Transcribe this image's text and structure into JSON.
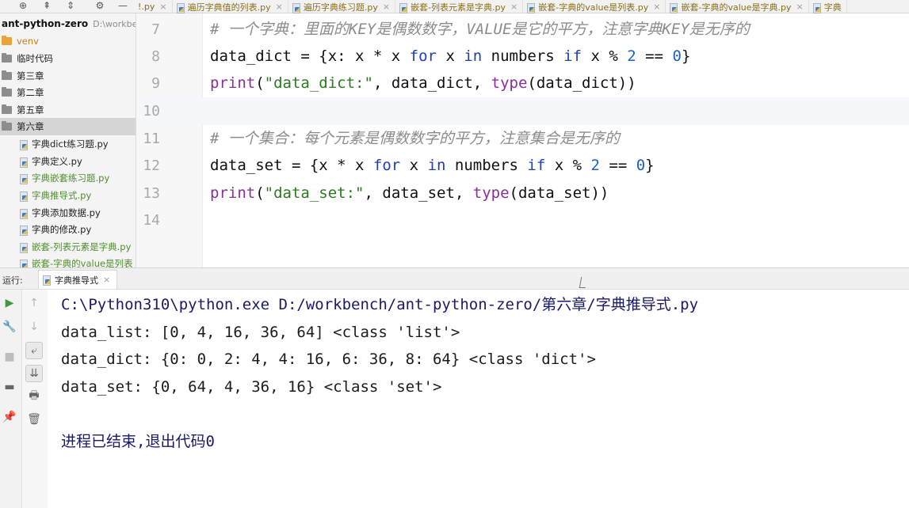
{
  "toolbar": {
    "target_icon": "crosshair-icon",
    "collapse_icon": "collapse-all-icon",
    "expand_icon": "expand-icon",
    "settings_icon": "gear-icon",
    "minimize_icon": "minimize-icon"
  },
  "tabs": [
    {
      "label": "!.py",
      "close": "×"
    },
    {
      "label": "遍历字典值的列表.py",
      "close": "×"
    },
    {
      "label": "遍历字典练习题.py",
      "close": "×"
    },
    {
      "label": "嵌套-列表元素是字典.py",
      "close": "×"
    },
    {
      "label": "嵌套-字典的value是列表.py",
      "close": "×"
    },
    {
      "label": "嵌套-字典的value是字典.py",
      "close": "×"
    },
    {
      "label": "字典",
      "close": ""
    }
  ],
  "sidebar": {
    "root_title": "ant-python-zero",
    "root_path": "D:\\workbench",
    "items": [
      {
        "label": "venv",
        "type": "folder-orange"
      },
      {
        "label": "临时代码",
        "type": "folder"
      },
      {
        "label": "第三章",
        "type": "folder"
      },
      {
        "label": "第二章",
        "type": "folder"
      },
      {
        "label": "第五章",
        "type": "folder"
      },
      {
        "label": "第六章",
        "type": "folder-selected"
      },
      {
        "label": "字典dict练习题.py",
        "type": "file"
      },
      {
        "label": "字典定义.py",
        "type": "file"
      },
      {
        "label": "字典嵌套练习题.py",
        "type": "file-green"
      },
      {
        "label": "字典推导式.py",
        "type": "file-green"
      },
      {
        "label": "字典添加数据.py",
        "type": "file"
      },
      {
        "label": "字典的修改.py",
        "type": "file"
      },
      {
        "label": "嵌套-列表元素是字典.py",
        "type": "file-green"
      },
      {
        "label": "嵌套-字典的value是列表",
        "type": "file-green"
      }
    ]
  },
  "editor": {
    "current_line": 10,
    "lines": [
      {
        "num": "7",
        "text": "# 一个字典：里面的KEY是偶数数字，VALUE是它的平方，注意字典KEY是无序的"
      },
      {
        "num": "8",
        "text": "data_dict = {x: x * x for x in numbers if x % 2 == 0}"
      },
      {
        "num": "9",
        "text": "print(\"data_dict:\", data_dict, type(data_dict))"
      },
      {
        "num": "10",
        "text": ""
      },
      {
        "num": "11",
        "text": "# 一个集合：每个元素是偶数数字的平方，注意集合是无序的"
      },
      {
        "num": "12",
        "text": "data_set = {x * x for x in numbers if x % 2 == 0}"
      },
      {
        "num": "13",
        "text": "print(\"data_set:\", data_set, type(data_set))"
      },
      {
        "num": "14",
        "text": ""
      }
    ]
  },
  "run_panel": {
    "label": "运行:",
    "tab_label": "字典推导式",
    "tab_close": "×",
    "output": [
      "C:\\Python310\\python.exe D:/workbench/ant-python-zero/第六章/字典推导式.py",
      "data_list: [0, 4, 16, 36, 64] <class 'list'>",
      "data_dict: {0: 0, 2: 4, 4: 16, 6: 36, 8: 64} <class 'dict'>",
      "data_set: {0, 64, 4, 36, 16} <class 'set'>",
      "",
      "进程已结束,退出代码0"
    ]
  },
  "colors": {
    "keyword": "#1f3fb5",
    "string": "#2a7a1e",
    "number": "#1a62c4",
    "comment": "#8c8c8c",
    "builtin": "#8a2e9a",
    "run_green": "#3f9a3a"
  }
}
